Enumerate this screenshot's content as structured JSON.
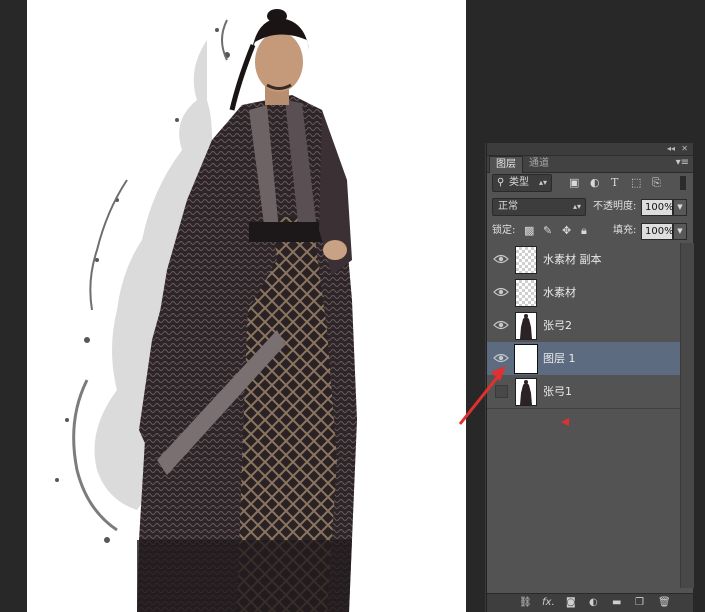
{
  "panel": {
    "tabs": [
      {
        "label": "图层",
        "active": true
      },
      {
        "label": "通道",
        "active": false
      }
    ],
    "filter": {
      "label": "类型",
      "icon": "search-icon"
    },
    "filter_icons": [
      "image-filter-icon",
      "adjustment-filter-icon",
      "text-filter-icon",
      "shape-filter-icon",
      "smart-object-filter-icon"
    ],
    "blend_mode": "正常",
    "opacity_label": "不透明度:",
    "opacity_value": "100%",
    "lock_label": "锁定:",
    "lock_icons": [
      "lock-transparent-icon",
      "lock-paint-icon",
      "lock-move-icon",
      "lock-all-icon"
    ],
    "fill_label": "填充:",
    "fill_value": "100%",
    "layers": [
      {
        "name": "水素材 副本",
        "visible": true,
        "thumb": "transparent",
        "selected": false
      },
      {
        "name": "水素材",
        "visible": true,
        "thumb": "transparent",
        "selected": false
      },
      {
        "name": "张弓2",
        "visible": true,
        "thumb": "figure",
        "selected": false
      },
      {
        "name": "图层 1",
        "visible": true,
        "thumb": "white",
        "selected": true
      },
      {
        "name": "张弓1",
        "visible": false,
        "thumb": "figure",
        "selected": false
      }
    ],
    "bottom_icons": [
      "link-layers-icon",
      "fx-icon",
      "add-mask-icon",
      "adjustment-layer-icon",
      "group-folder-icon",
      "new-layer-icon",
      "trash-icon"
    ],
    "bottom_fx_label": "fx."
  },
  "colors": {
    "workspace": "#282828",
    "panel": "#535353",
    "selected_layer": "#5c6b80",
    "annotation": "#e23030"
  }
}
